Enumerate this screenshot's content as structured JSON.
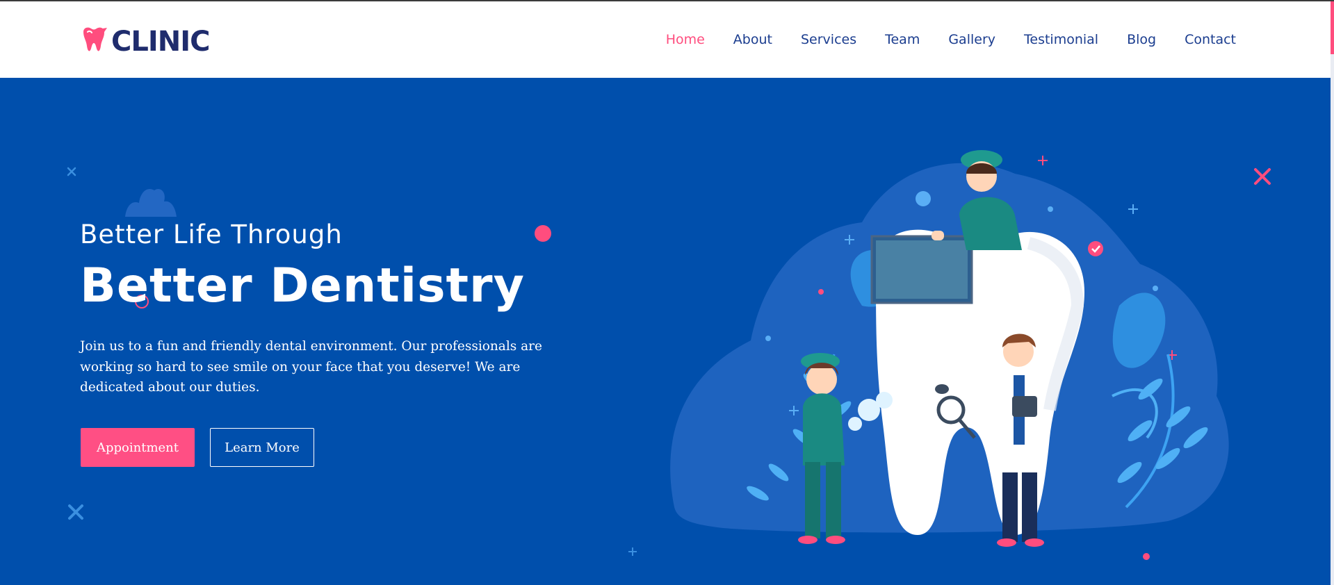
{
  "brand": {
    "name": "CLINIC"
  },
  "nav": {
    "items": [
      "Home",
      "About",
      "Services",
      "Team",
      "Gallery",
      "Testimonial",
      "Blog",
      "Contact"
    ],
    "active": "Home"
  },
  "hero": {
    "subtitle": "Better Life Through",
    "title": "Better Dentistry",
    "description": "Join us to a fun and friendly dental environment. Our professionals are working so hard to see smile on your face that you deserve! We are dedicated about our duties.",
    "primary_button": "Appointment",
    "secondary_button": "Learn More"
  },
  "colors": {
    "hero_bg": "#004fac",
    "accent": "#ff4d7e",
    "brand_dark": "#1f2c6d",
    "nav_text": "#1b3d8f"
  },
  "icons": [
    "tooth-logo-icon",
    "dentist-illustration"
  ]
}
